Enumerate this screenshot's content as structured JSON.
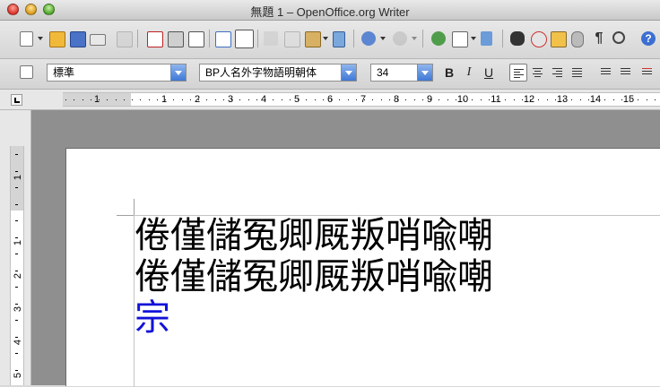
{
  "window": {
    "title": "無題 1 – OpenOffice.org Writer"
  },
  "toolbar_standard": {
    "icons": [
      "new-document-icon",
      "open-icon",
      "save-icon",
      "email-icon",
      "edit-file-icon",
      "export-pdf-icon",
      "print-icon",
      "print-preview-icon",
      "spellcheck-icon",
      "autospellcheck-icon",
      "cut-icon",
      "copy-icon",
      "paste-icon",
      "clone-formatting-icon",
      "undo-icon",
      "redo-icon",
      "hyperlink-icon",
      "table-icon",
      "draw-functions-icon",
      "find-replace-icon",
      "navigator-icon",
      "gallery-icon",
      "data-sources-icon",
      "nonprinting-characters-icon",
      "zoom-icon",
      "help-icon"
    ]
  },
  "toolbar_formatting": {
    "style_value": "標準",
    "font_value": "BP人名外字物語明朝体",
    "size_value": "34",
    "bold_label": "B",
    "italic_label": "I",
    "underline_label": "U"
  },
  "ruler": {
    "labels": [
      "1",
      "1",
      "2",
      "3",
      "4",
      "5",
      "6",
      "7",
      "8",
      "9",
      "10",
      "11",
      "12",
      "13",
      "14",
      "15"
    ]
  },
  "vertical_ruler": {
    "labels": [
      "1",
      "1",
      "2",
      "3",
      "4",
      "5"
    ]
  },
  "document": {
    "lines": [
      "倦僅儲冤卿厩叛哨喩嘲",
      "倦僅儲冤卿厩叛哨喩嘲"
    ],
    "blue_line": "宗",
    "blue_color": "#1212d8"
  }
}
